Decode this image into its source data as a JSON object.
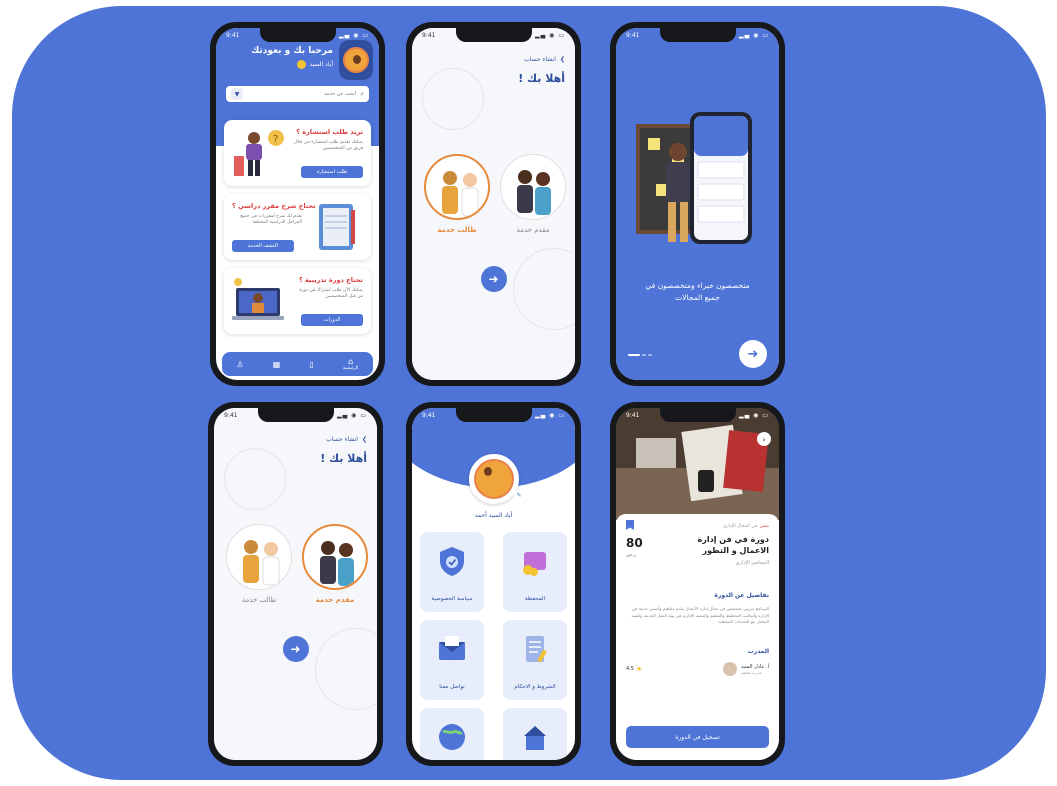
{
  "colors": {
    "background": "#4d74d6",
    "primary": "#4d74d6",
    "dark_blue": "#2f4f9e",
    "accent_orange": "#e78a3c",
    "accent_red": "#d93b3b"
  },
  "status_time": "9:41",
  "home": {
    "greeting": "مرحبا بك و بعودتك",
    "user_name": "أياد السيد",
    "search_placeholder": "ابحث عن خدمة",
    "cards": [
      {
        "title": "تريد طلب استشارة ؟",
        "desc": "يمكنك تقديم طلب استشارة من خلال فريق من المتخصصين",
        "button": "طلب استشارة"
      },
      {
        "title": "تحتاج شرح مقرر دراسي ؟",
        "desc": "نقدم لك شرح لمقررات في جميع المراحل الدراسية المختلفة",
        "button": "اكتشف الخدمة"
      },
      {
        "title": "تحتاج دورة تدريبية ؟",
        "desc": "يمكنك الآن طلب اشتراك في دورة من قبل المتخصصين",
        "button": "الدورات"
      }
    ],
    "nav": [
      {
        "icon": "user-icon",
        "label": ""
      },
      {
        "icon": "grid-icon",
        "label": ""
      },
      {
        "icon": "file-icon",
        "label": ""
      },
      {
        "icon": "home-icon",
        "label": "الرئيسية"
      }
    ]
  },
  "choose_a": {
    "back_label": "انشاء حساب",
    "welcome": "أهلا بك !",
    "option_provider": "مقدم خدمة",
    "option_student": "طالب خدمة"
  },
  "choose_b": {
    "back_label": "انشاء حساب",
    "welcome": "أهلا بك !",
    "option_provider": "مقدم خدمة",
    "option_student": "طالب خدمة"
  },
  "onboarding": {
    "text_line1": "متخصصون خبراء ومتخصصون في",
    "text_line2": "جميع المجالات"
  },
  "settings": {
    "user_name": "أياد السيد أحمد",
    "tiles": [
      {
        "label": "المحفظة",
        "icon": "wallet-icon"
      },
      {
        "label": "سياسة الخصوصية",
        "icon": "shield-icon"
      },
      {
        "label": "الشروط و الاحكام",
        "icon": "document-icon"
      },
      {
        "label": "تواصل معنا",
        "icon": "mail-icon"
      },
      {
        "label": "",
        "icon": "globe-icon"
      },
      {
        "label": "",
        "icon": "building-icon"
      }
    ]
  },
  "course": {
    "tag": "مميز",
    "meta": "في المجال الإداري",
    "title": "دورة في فن إدارة الاعمال و التطور",
    "price": "80",
    "currency": "ر.س",
    "subtitle": "المحاضر الإداري",
    "details_title": "تفاصيل عن الدورة",
    "details_text": "البرنامج تدريبي متخصص في مجال إدارة الأعمال يقدم مفاهيم وأسس حديثة في الإدارة وأساليب التخطيط والتنظيم والتنمية الإدارية في بيئة العمل الحديثة وكيفية التعامل مع التحديات المختلفة",
    "trainer_title": "المدرب",
    "trainer_name": "أ. عادل السيد",
    "trainer_role": "مدرب معتمد",
    "rating": "4.5",
    "apply_button": "تسجيل في الدورة"
  }
}
